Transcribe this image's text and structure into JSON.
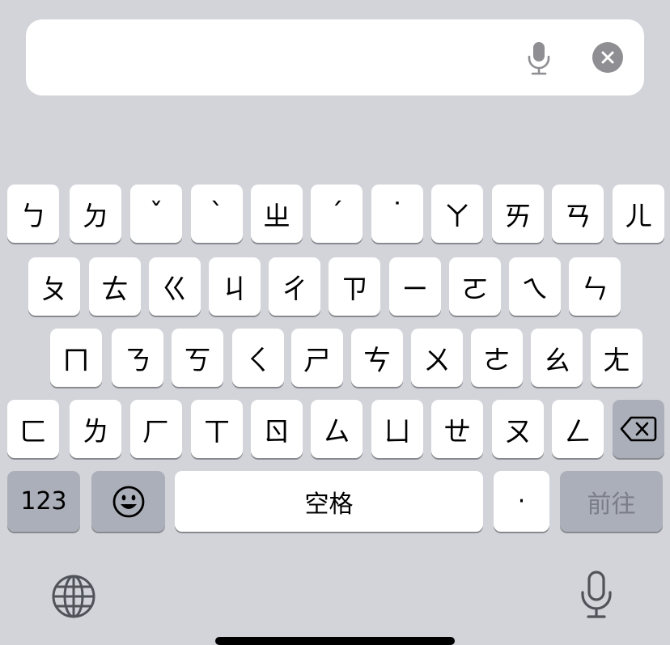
{
  "search": {
    "value": "",
    "placeholder": ""
  },
  "icons": {
    "field_mic": "microphone-icon",
    "clear": "clear-circle-x-icon",
    "backspace": "backspace-icon",
    "emoji": "smiley-face-icon",
    "globe": "globe-icon",
    "dictation": "microphone-icon"
  },
  "keyboard": {
    "rows": [
      [
        "ㄅ",
        "ㄉ",
        "ˇ",
        "ˋ",
        "ㄓ",
        "ˊ",
        "˙",
        "ㄚ",
        "ㄞ",
        "ㄢ",
        "ㄦ"
      ],
      [
        "ㄆ",
        "ㄊ",
        "ㄍ",
        "ㄐ",
        "ㄔ",
        "ㄗ",
        "ㄧ",
        "ㄛ",
        "ㄟ",
        "ㄣ"
      ],
      [
        "ㄇ",
        "ㄋ",
        "ㄎ",
        "ㄑ",
        "ㄕ",
        "ㄘ",
        "ㄨ",
        "ㄜ",
        "ㄠ",
        "ㄤ"
      ],
      [
        "ㄈ",
        "ㄌ",
        "ㄏ",
        "ㄒ",
        "ㄖ",
        "ㄙ",
        "ㄩ",
        "ㄝ",
        "ㄡ",
        "ㄥ"
      ]
    ],
    "numbers_label": "123",
    "space_label": "空格",
    "punct_label": "·",
    "send_label": "前往"
  },
  "colors": {
    "keyboard_bg": "#d3d4da",
    "key_bg": "#ffffff",
    "function_key_bg": "#abafb9",
    "send_text": "#7b7e86"
  }
}
